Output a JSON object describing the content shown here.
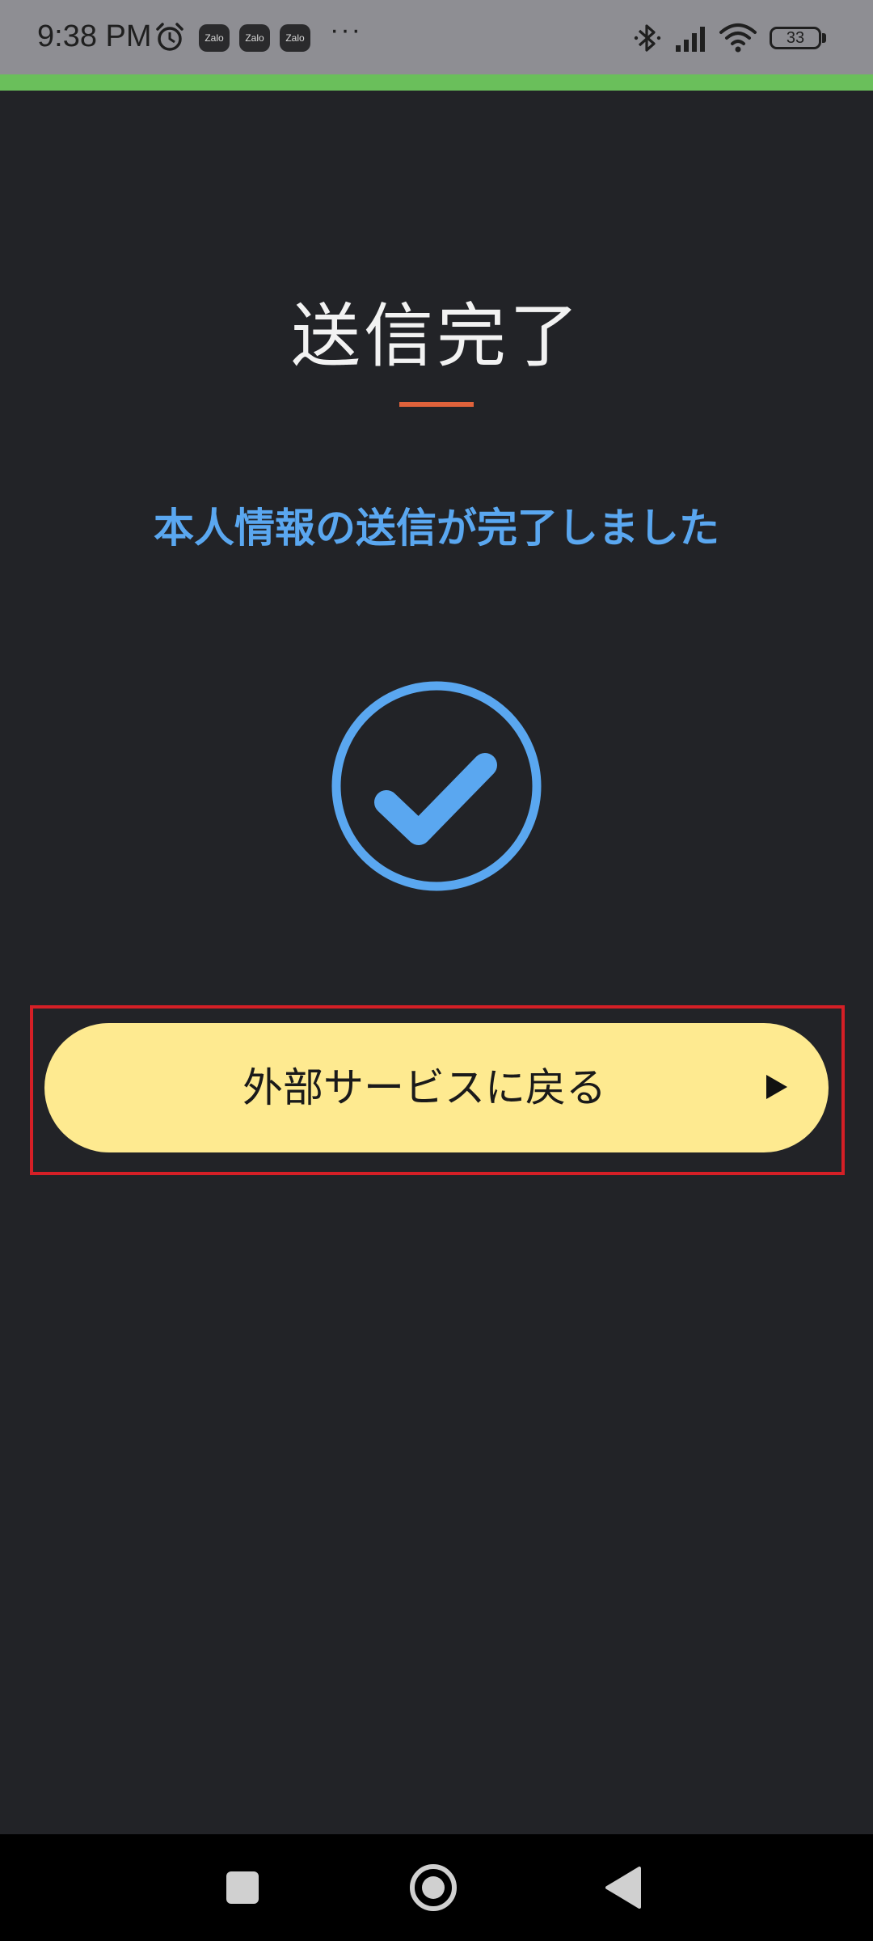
{
  "status_bar": {
    "time": "9:38 PM",
    "alarm_icon": "alarm-clock-icon",
    "notification_apps": [
      "Zalo",
      "Zalo",
      "Zalo"
    ],
    "more_indicator": "···",
    "bluetooth_icon": "bluetooth-icon",
    "signal_icon": "cell-signal-icon",
    "wifi_icon": "wifi-icon",
    "battery_level": "33"
  },
  "progress": {
    "color": "#6abf5b",
    "fraction": 1.0
  },
  "main": {
    "title": "送信完了",
    "divider_color": "#e0623b",
    "subtitle": "本人情報の送信が完了しました",
    "subtitle_color": "#5aa7f0",
    "status_icon": "check-circle-icon",
    "return_button": {
      "label": "外部サービスに戻る",
      "icon": "play-arrow-icon",
      "background": "#feea90"
    }
  },
  "nav_bar": {
    "recents_icon": "square-recents-icon",
    "home_icon": "circle-home-icon",
    "back_icon": "triangle-back-icon"
  }
}
